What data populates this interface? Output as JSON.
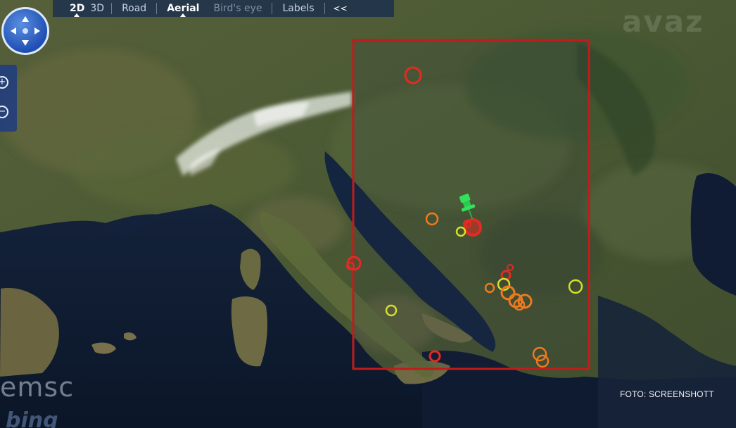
{
  "toolbar": {
    "view_2d": "2D",
    "view_3d": "3D",
    "road": "Road",
    "aerial": "Aerial",
    "birds_eye": "Bird's eye",
    "labels": "Labels",
    "collapse": "<<",
    "selected_dimension": "2D",
    "selected_map_style": "Aerial"
  },
  "controls": {
    "zoom_in": "+",
    "zoom_out": "−"
  },
  "overlay": {
    "watermark": "avaz",
    "provider_logo": "emsc",
    "map_logo": "bing",
    "photo_credit": "FOTO: SCREENSHOTT"
  },
  "map": {
    "type": "aerial satellite map of Italy and the Balkans",
    "selection_box_color": "#c01c1c",
    "main_pin_color": "#33e05a",
    "marker_colors": {
      "red": "#e52a23",
      "orange": "#f07a1e",
      "yellow": "#d7dd2a"
    },
    "markers_count": 20
  }
}
